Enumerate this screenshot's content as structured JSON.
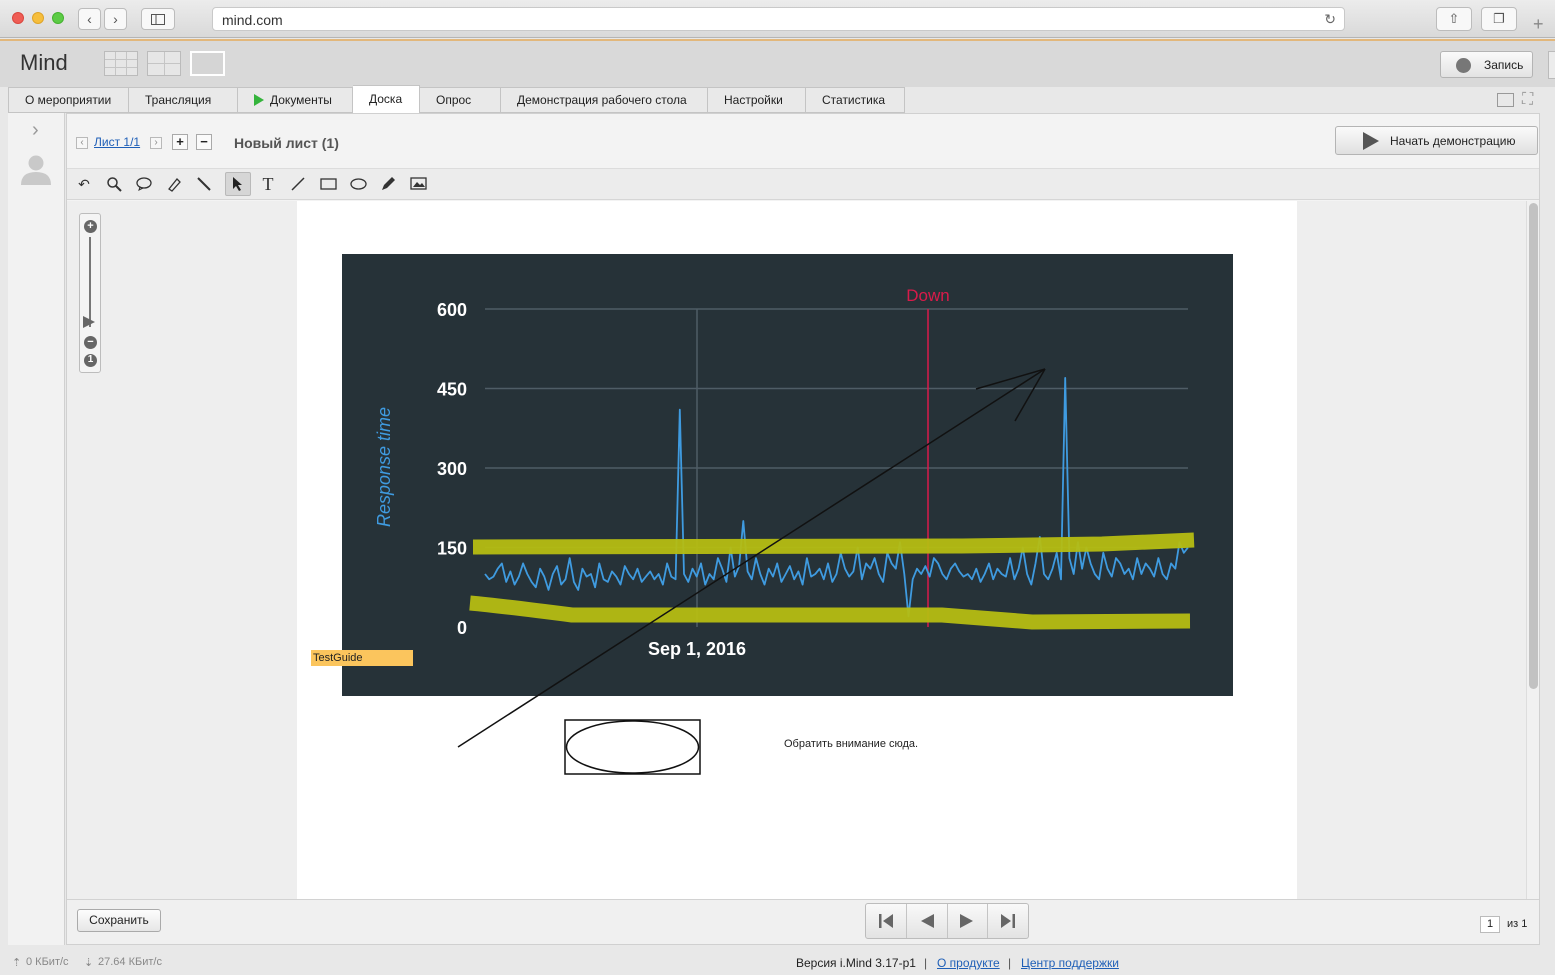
{
  "browser": {
    "url": "mind.com"
  },
  "app": {
    "title": "Mind",
    "record_label": "Запись"
  },
  "tabs": [
    {
      "label": "О мероприятии"
    },
    {
      "label": "Трансляция"
    },
    {
      "label": "Документы"
    },
    {
      "label": "Доска"
    },
    {
      "label": "Опрос"
    },
    {
      "label": "Демонстрация рабочего стола"
    },
    {
      "label": "Настройки"
    },
    {
      "label": "Статистика"
    }
  ],
  "active_tab": "Доска",
  "sheet": {
    "nav_label": "Лист 1/1",
    "name": "Новый лист (1)",
    "start_demo_label": "Начать демонстрацию"
  },
  "board": {
    "tag_label": "TestGuide",
    "note_text": "Обратить внимание сюда.",
    "highlight_color": "#b5bd12",
    "chart_background": "#263238"
  },
  "chart_data": {
    "type": "line",
    "ylabel": "Response time",
    "ylim": [
      0,
      600
    ],
    "yticks": [
      600,
      450,
      300,
      150,
      0
    ],
    "xtick_labels": [
      "Sep 1, 2016"
    ],
    "annotation": {
      "label": "Down",
      "color": "#d81b4a"
    },
    "series": [
      {
        "color": "#3f9be0",
        "values": [
          100,
          90,
          95,
          110,
          120,
          85,
          105,
          80,
          95,
          120,
          100,
          85,
          75,
          110,
          95,
          70,
          100,
          115,
          80,
          90,
          130,
          85,
          70,
          110,
          95,
          100,
          75,
          120,
          90,
          85,
          105,
          95,
          80,
          115,
          100,
          90,
          110,
          85,
          95,
          105,
          90,
          100,
          80,
          120,
          95,
          90,
          410,
          100,
          85,
          110,
          95,
          120,
          80,
          100,
          90,
          130,
          110,
          85,
          150,
          95,
          115,
          200,
          105,
          90,
          130,
          100,
          80,
          110,
          95,
          120,
          85,
          100,
          115,
          90,
          105,
          80,
          130,
          95,
          100,
          110,
          90,
          120,
          85,
          100,
          140,
          110,
          95,
          105,
          150,
          90,
          120,
          110,
          130,
          100,
          85,
          140,
          120,
          110,
          160,
          100,
          20,
          90,
          110,
          100,
          115,
          95,
          130,
          120,
          100,
          90,
          110,
          120,
          105,
          95,
          100,
          90,
          110,
          85,
          100,
          120,
          90,
          110,
          100,
          95,
          130,
          90,
          110,
          150,
          100,
          80,
          120,
          170,
          100,
          90,
          110,
          140,
          90,
          470,
          130,
          100,
          160,
          110,
          150,
          120,
          100,
          90,
          140,
          110,
          95,
          130,
          120,
          100,
          110,
          90,
          130,
          100,
          120,
          110,
          95,
          130,
          100,
          90,
          120,
          110,
          160,
          140,
          150
        ]
      }
    ]
  },
  "bottom": {
    "save_label": "Сохранить",
    "page_number": "1",
    "page_of": "из 1"
  },
  "status": {
    "upload": "0 КБит/с",
    "download": "27.64 КБит/с",
    "version": "Версия i.Mind 3.17-p1",
    "sep": "|",
    "link_product": "О продукте",
    "link_support": "Центр поддержки"
  }
}
